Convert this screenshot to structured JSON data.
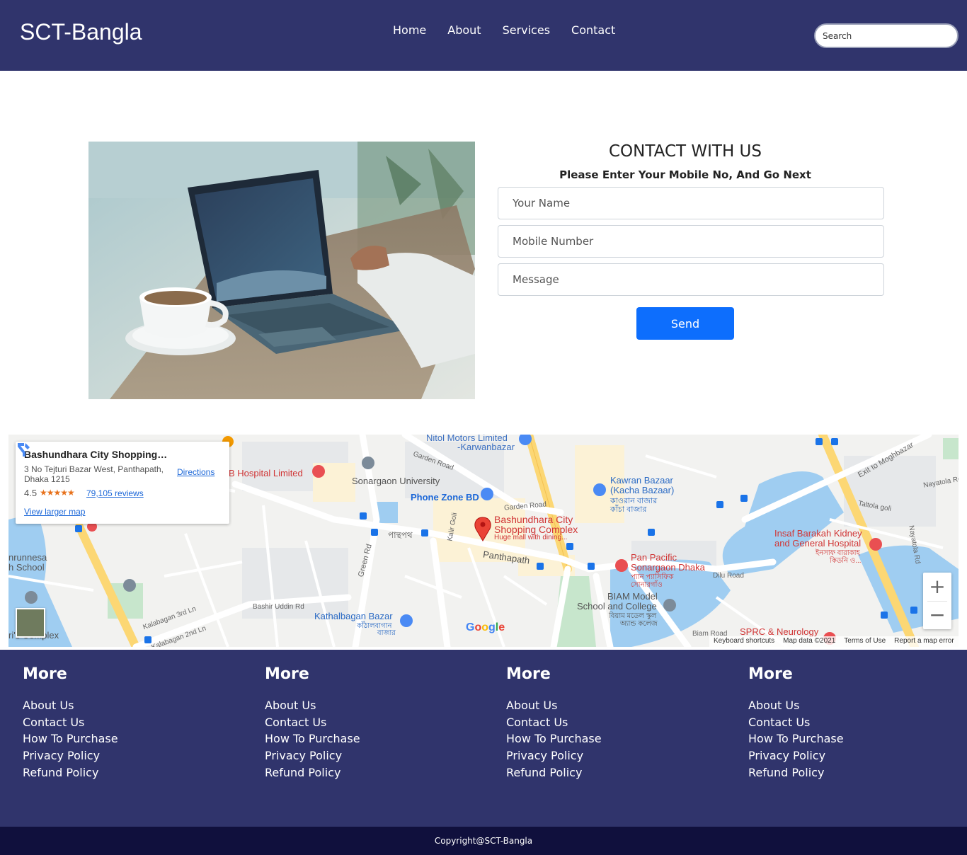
{
  "header": {
    "brand": "SCT-Bangla",
    "nav": [
      "Home",
      "About",
      "Services",
      "Contact"
    ],
    "search_placeholder": "Search"
  },
  "contact": {
    "title": "CONTACT WITH US",
    "subtitle": "Please Enter Your Mobile No, And Go Next",
    "name_placeholder": "Your Name",
    "mobile_placeholder": "Mobile Number",
    "message_placeholder": "Message",
    "send_label": "Send"
  },
  "map": {
    "card": {
      "name": "Bashundhara City Shopping C...",
      "address": "3 No Tejturi Bazar West, Panthapath, Dhaka 1215",
      "rating": "4.5",
      "stars": "★★★★★",
      "reviews": "79,105 reviews",
      "directions": "Directions",
      "larger_map": "View larger map"
    },
    "labels": {
      "nitol": "Nitol Motors Limited",
      "karwan": "-Karwanbazar",
      "hospital": "B Hospital Limited",
      "sonargaon_univ": "Sonargaon University",
      "phone_zone": "Phone Zone BD",
      "kawran": "Kawran Bazaar",
      "kacha": "(Kacha Bazaar)",
      "kawran_bn": "কাওরান বাজার",
      "kacha_bn": "কাঁচা বাজার",
      "bashundhara1": "Bashundhara City",
      "bashundhara2": "Shopping Complex",
      "bashundhara3": "Huge mall with dining...",
      "panthapath": "Panthapath",
      "panthapath_bn": "পান্থপথ",
      "pan_pacific1": "Pan Pacific",
      "pan_pacific2": "Sonargaon Dhaka",
      "pan_pacific_bn1": "প্যান প্যাসিফিক",
      "pan_pacific_bn2": "সোনারগাঁও",
      "biam1": "BIAM Model",
      "biam2": "School and College",
      "biam_bn1": "বিয়াম মডেল স্কুল",
      "biam_bn2": "অ্যান্ড কলেজ",
      "insaf1": "Insaf Barakah Kidney",
      "insaf2": "and General Hospital",
      "insaf_bn1": "ইনসাফ বারাকাহ",
      "insaf_bn2": "কিডনি ও...",
      "kathalbagan": "Kathalbagan Bazar",
      "kathalbagan_bn1": "কাঁঠালবাগান",
      "kathalbagan_bn2": "বাজার",
      "sprc": "SPRC & Neurology",
      "exit": "Exit to Moghbazar",
      "garden_road": "Garden Road",
      "garden_road2": "Garden Road",
      "green_rd": "Green Rd",
      "kalir_goli": "Kalir Goli",
      "dilu_road": "Dilu Road",
      "biam_road": "Biam Road",
      "bashir_uddin": "Bashir Uddin Rd",
      "kalabagan3": "Kalabagan 3rd Ln",
      "kalabagan2": "Kalabagan 2nd Ln",
      "nayatola": "Nayatola Rd",
      "taltola": "Taltola goli",
      "nayatola2": "Nayatola Rd",
      "arunnesa1": "nrunnesa",
      "arunnesa2": "h School",
      "complex": "ri's Complex"
    },
    "google": "Google",
    "attribution": [
      "Keyboard shortcuts",
      "Map data ©2021",
      "Terms of Use",
      "Report a map error"
    ]
  },
  "footer": {
    "columns": [
      {
        "title": "More",
        "links": [
          "About Us",
          "Contact Us",
          "How To Purchase",
          "Privacy Policy",
          "Refund Policy"
        ]
      },
      {
        "title": "More",
        "links": [
          "About Us",
          "Contact Us",
          "How To Purchase",
          "Privacy Policy",
          "Refund Policy"
        ]
      },
      {
        "title": "More",
        "links": [
          "About Us",
          "Contact Us",
          "How To Purchase",
          "Privacy Policy",
          "Refund Policy"
        ]
      },
      {
        "title": "More",
        "links": [
          "About Us",
          "Contact Us",
          "How To Purchase",
          "Privacy Policy",
          "Refund Policy"
        ]
      }
    ],
    "copyright": "Copyright@SCT-Bangla"
  },
  "colors": {
    "header_bg": "#30346c",
    "copyright_bg": "#10103d",
    "primary_button": "#0d6efd"
  }
}
